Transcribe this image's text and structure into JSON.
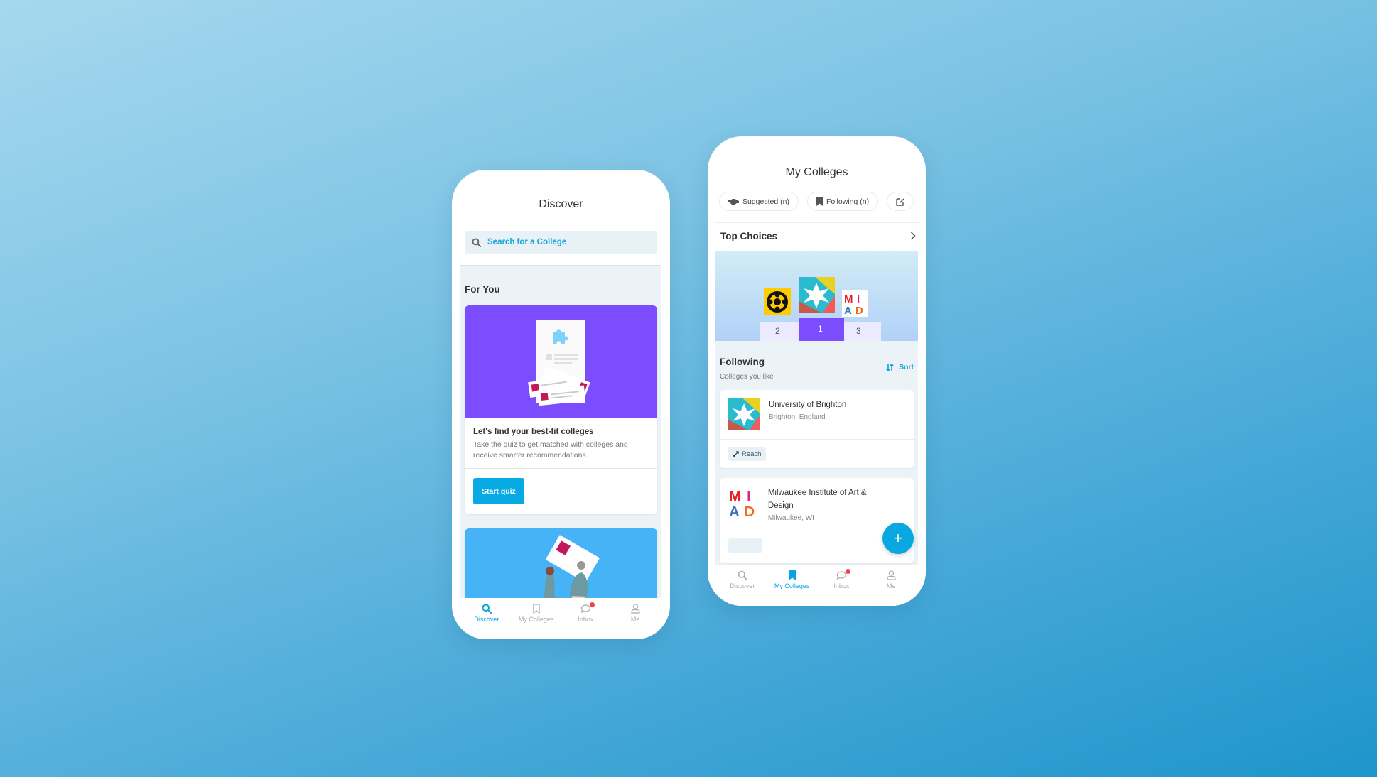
{
  "discover": {
    "title": "Discover",
    "search_placeholder": "Search for a College",
    "section_title": "For You",
    "quiz_card": {
      "title": "Let's find your best-fit colleges",
      "description": "Take the quiz to get matched with colleges and receive smarter recommendations",
      "button": "Start quiz"
    }
  },
  "nav": {
    "items": [
      {
        "label": "Discover",
        "icon": "search-icon"
      },
      {
        "label": "My Colleges",
        "icon": "bookmark-icon"
      },
      {
        "label": "Inbox",
        "icon": "chat-icon"
      },
      {
        "label": "Me",
        "icon": "person-icon"
      }
    ]
  },
  "my_colleges": {
    "title": "My Colleges",
    "chips": [
      {
        "label": "Suggested (n)",
        "icon": "handshake-icon"
      },
      {
        "label": "Following (n)",
        "icon": "bookmark-icon"
      },
      {
        "label": "",
        "icon": "edit-icon"
      }
    ],
    "top_choices": {
      "label": "Top Choices",
      "podium": [
        "2",
        "1",
        "3"
      ]
    },
    "following": {
      "title": "Following",
      "subtitle": "Colleges you like",
      "sort_label": "Sort"
    },
    "colleges": [
      {
        "name": "University of Brighton",
        "location": "Brighton, England",
        "tag": "Reach"
      },
      {
        "name": "Milwaukee Institute of Art & Design",
        "location": "Milwaukee, WI",
        "tag": ""
      }
    ],
    "fab_label": "+"
  },
  "colors": {
    "accent": "#0aa8e1",
    "purple": "#7c4dff",
    "notification": "#ff3b4a"
  }
}
